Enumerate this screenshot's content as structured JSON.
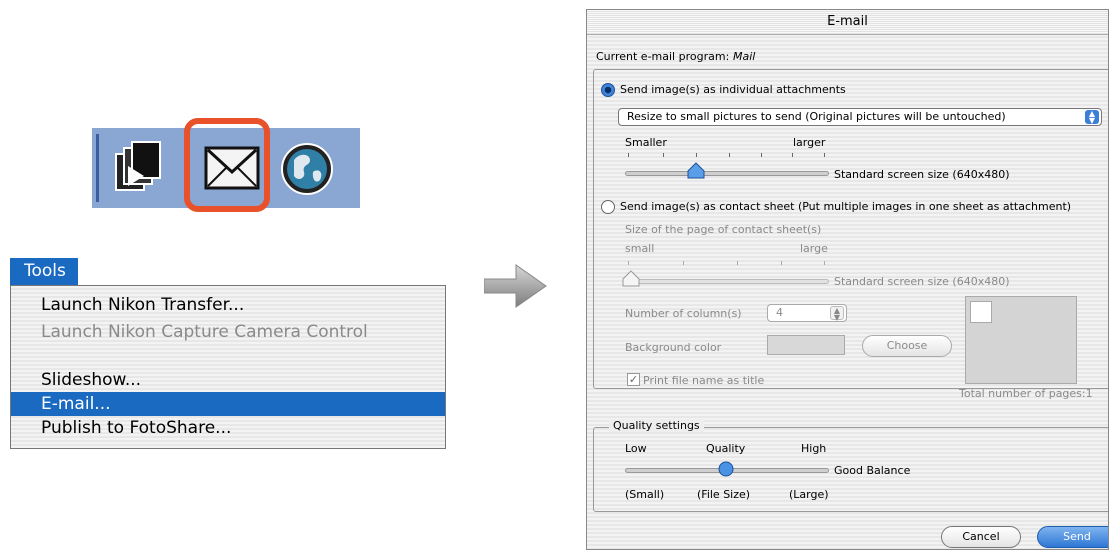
{
  "toolbar": {
    "icons": [
      "transfer-icon",
      "email-icon",
      "globe-icon"
    ],
    "highlight_color": "#e8512a"
  },
  "tools_menu": {
    "title": "Tools",
    "items": [
      {
        "label": "Launch Nikon Transfer...",
        "enabled": true,
        "selected": false
      },
      {
        "label": "Launch Nikon Capture Camera Control",
        "enabled": false,
        "selected": false
      },
      {
        "label": "Slideshow...",
        "enabled": true,
        "selected": false
      },
      {
        "label": "E-mail...",
        "enabled": true,
        "selected": true
      },
      {
        "label": "Publish to FotoShare...",
        "enabled": true,
        "selected": false
      }
    ],
    "selection_color": "#1a6ac2"
  },
  "dialog": {
    "title": "E-mail",
    "current_program_label": "Current e-mail program:",
    "current_program_value": "Mail",
    "individual": {
      "label": "Send image(s) as individual attachments",
      "selected": true,
      "resize_option": "Resize to small pictures to send (Original pictures will be untouched)",
      "slider_min_label": "Smaller",
      "slider_max_label": "larger",
      "slider_value_text": "Standard screen size (640x480)",
      "slider_level": 0.3
    },
    "contact_sheet": {
      "label": "Send image(s) as contact sheet (Put multiple images in one sheet as attachment)",
      "selected": false,
      "page_size_label": "Size of the page of contact sheet(s)",
      "slider_min_label": "small",
      "slider_max_label": "large",
      "slider_value_text": "Standard screen size (640x480)",
      "slider_level": 0,
      "columns_label": "Number of column(s)",
      "columns_value": "4",
      "background_label": "Background color",
      "choose_label": "Choose",
      "print_name_label": "Print file name as title",
      "print_name_checked": true,
      "total_pages_text": "Total number of pages:1"
    },
    "quality": {
      "group_label": "Quality settings",
      "low_label": "Low",
      "quality_label": "Quality",
      "high_label": "High",
      "value_text": "Good Balance",
      "small_label": "(Small)",
      "file_size_label": "(File Size)",
      "large_label": "(Large)",
      "slider_level": 0.5
    },
    "cancel_label": "Cancel",
    "send_label": "Send",
    "accent_color": "#2f77d4"
  }
}
